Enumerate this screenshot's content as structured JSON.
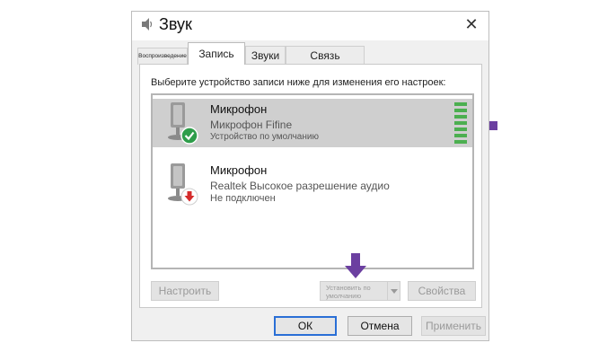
{
  "window": {
    "title": "Звук"
  },
  "tabs": [
    {
      "label": "Воспроизведение",
      "active": false
    },
    {
      "label": "Запись",
      "active": true
    },
    {
      "label": "Звуки",
      "active": false
    },
    {
      "label": "Связь",
      "active": false
    }
  ],
  "instruction": "Выберите устройство записи ниже для изменения его настроек:",
  "devices": [
    {
      "name": "Микрофон",
      "line2": "Микрофон Fifine",
      "line3": "Устройство по умолчанию",
      "status": "default",
      "selected": true,
      "level": 1.0
    },
    {
      "name": "Микрофон",
      "line2": "Realtek Высокое разрешение аудио",
      "line3": "Не подключен",
      "status": "disconnected",
      "selected": false
    }
  ],
  "buttons": {
    "configure": "Настроить",
    "set_default_line1": "Установить по",
    "set_default_line2": "умолчанию",
    "properties": "Свойства",
    "ok": "ОК",
    "cancel": "Отмена",
    "apply": "Применить"
  },
  "icons": {
    "title": "speaker-icon",
    "close": "close-icon",
    "default_badge": "checkmark-icon",
    "disconnected_badge": "down-arrow-icon",
    "callouts": "callout-arrow-icon"
  },
  "colors": {
    "accent": "#2a6fd6",
    "callout": "#6b3fa0",
    "level": "#4caf50",
    "default_badge": "#2e9d4a",
    "disconnected_badge": "#d42b2b"
  }
}
